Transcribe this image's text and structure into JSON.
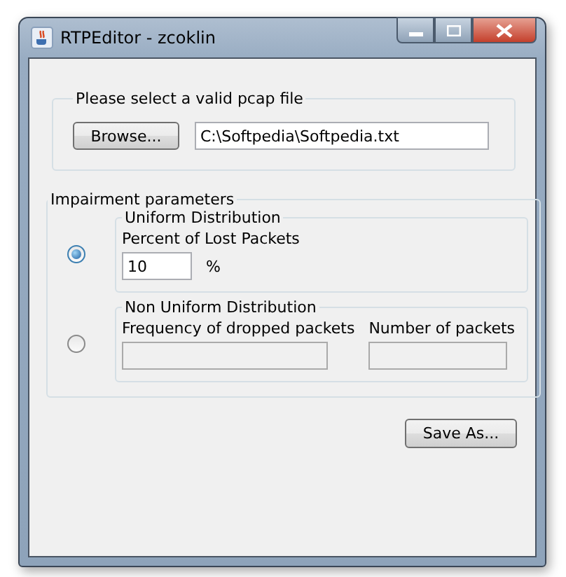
{
  "window": {
    "title": "RTPEditor - zcoklin"
  },
  "file_group": {
    "legend": "Please select a valid pcap file",
    "browse_button": "Browse...",
    "path": "C:\\Softpedia\\Softpedia.txt"
  },
  "impairment": {
    "legend": "Impairment parameters",
    "options": [
      {
        "kind": "uniform",
        "legend": "Uniform Distribution",
        "selected": true,
        "label": "Percent of Lost Packets",
        "value": "10",
        "unit": "%"
      },
      {
        "kind": "nonuniform",
        "legend": "Non Uniform Distribution",
        "selected": false,
        "label_1": "Frequency of dropped packets",
        "label_2": "Number of packets"
      }
    ]
  },
  "save_button": "Save As..."
}
